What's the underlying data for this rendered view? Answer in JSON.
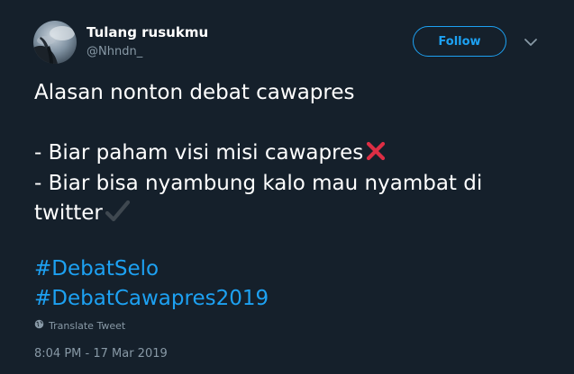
{
  "author": {
    "name": "Tulang rusukmu",
    "handle": "@Nhndn_",
    "avatar_icon": "profile-photo"
  },
  "actions": {
    "follow_label": "Follow",
    "menu_icon": "chevron-down-icon"
  },
  "tweet": {
    "lines": [
      "Alasan nonton debat cawapres",
      "- Biar paham visi misi cawapres",
      "- Biar bisa nyambung kalo mau nyambat di",
      "twitter"
    ],
    "emojis": [
      "cross-mark-icon",
      "check-mark-icon"
    ],
    "hashtags": [
      "#DebatSelo",
      "#DebatCawapres2019"
    ]
  },
  "translate_label": "Translate Tweet",
  "timestamp": "8:04 PM - 17 Mar 2019",
  "colors": {
    "background": "#15202b",
    "accent": "#1da1f2",
    "secondary_text": "#8899a6",
    "cross_mark": "#dd2e44"
  }
}
